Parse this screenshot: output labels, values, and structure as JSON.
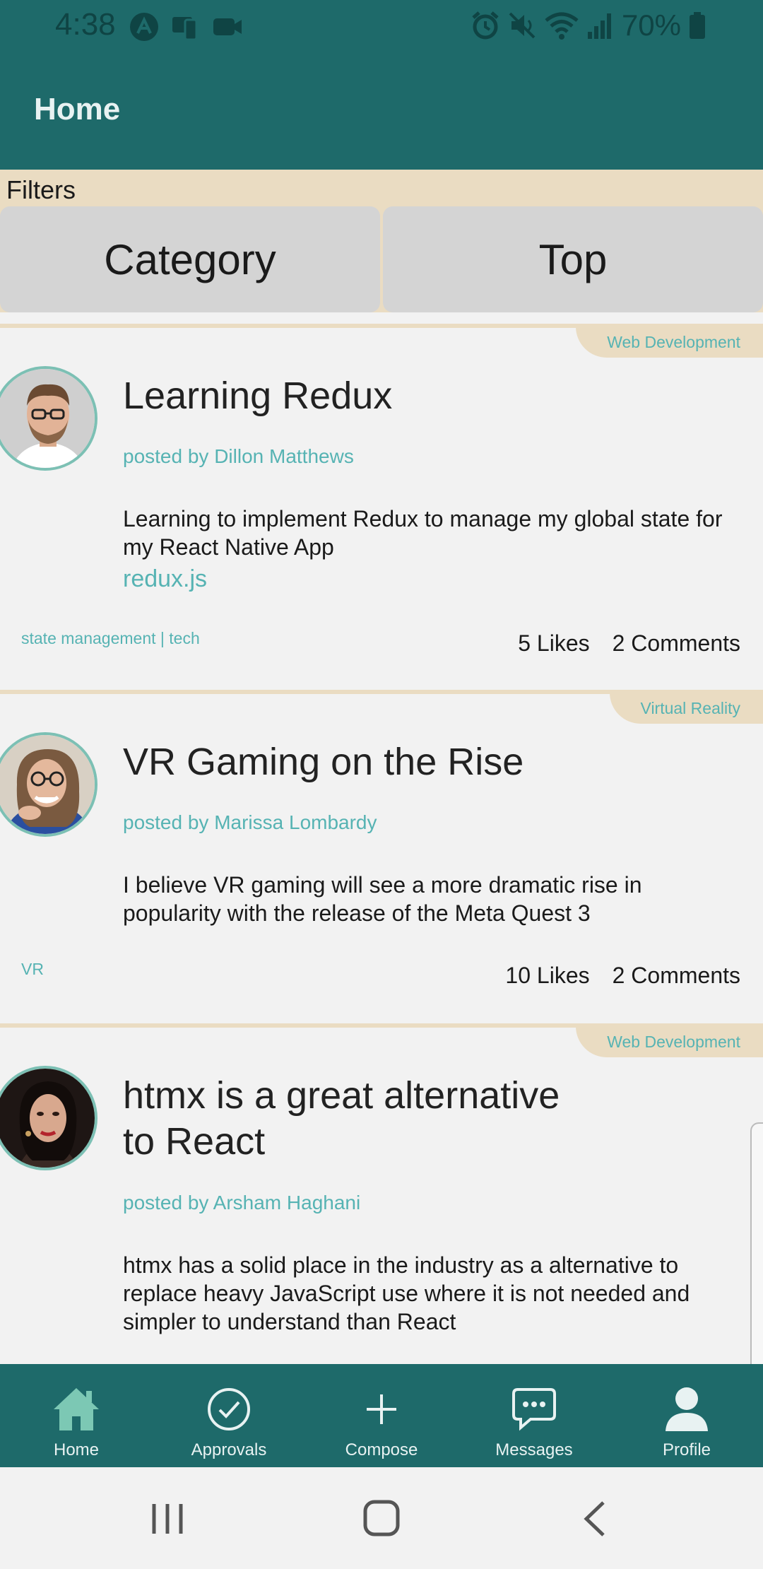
{
  "status_bar": {
    "time": "4:38",
    "battery": "70%"
  },
  "header": {
    "title": "Home"
  },
  "filters": {
    "label": "Filters",
    "category_button": "Category",
    "top_button": "Top"
  },
  "posts": [
    {
      "category": "Web Development",
      "title": "Learning Redux",
      "author": "posted by Dillon Matthews",
      "body": "Learning to implement Redux to manage my global state for my React Native App",
      "link": "redux.js",
      "tags": "state management | tech",
      "likes": "5 Likes",
      "comments": "2 Comments"
    },
    {
      "category": "Virtual Reality",
      "title": "VR Gaming on the Rise",
      "author": "posted by Marissa Lombardy",
      "body": "I believe VR gaming will see a more dramatic rise in popularity with the release of the Meta Quest 3",
      "tags": "VR",
      "likes": "10 Likes",
      "comments": "2 Comments"
    },
    {
      "category": "Web Development",
      "title_line1": "htmx is a great alternative",
      "title_line2": "to React",
      "author": "posted by Arsham Haghani",
      "body": "htmx has a solid place in the industry as a alternative to replace heavy JavaScript use where it is not needed and simpler to understand than React"
    }
  ],
  "bottom_nav": {
    "home": "Home",
    "approvals": "Approvals",
    "compose": "Compose",
    "messages": "Messages",
    "profile": "Profile"
  },
  "colors": {
    "primary": "#1e6a6a",
    "accent": "#56b3b3",
    "beige": "#eadcc2",
    "background": "#f2f2f2"
  }
}
